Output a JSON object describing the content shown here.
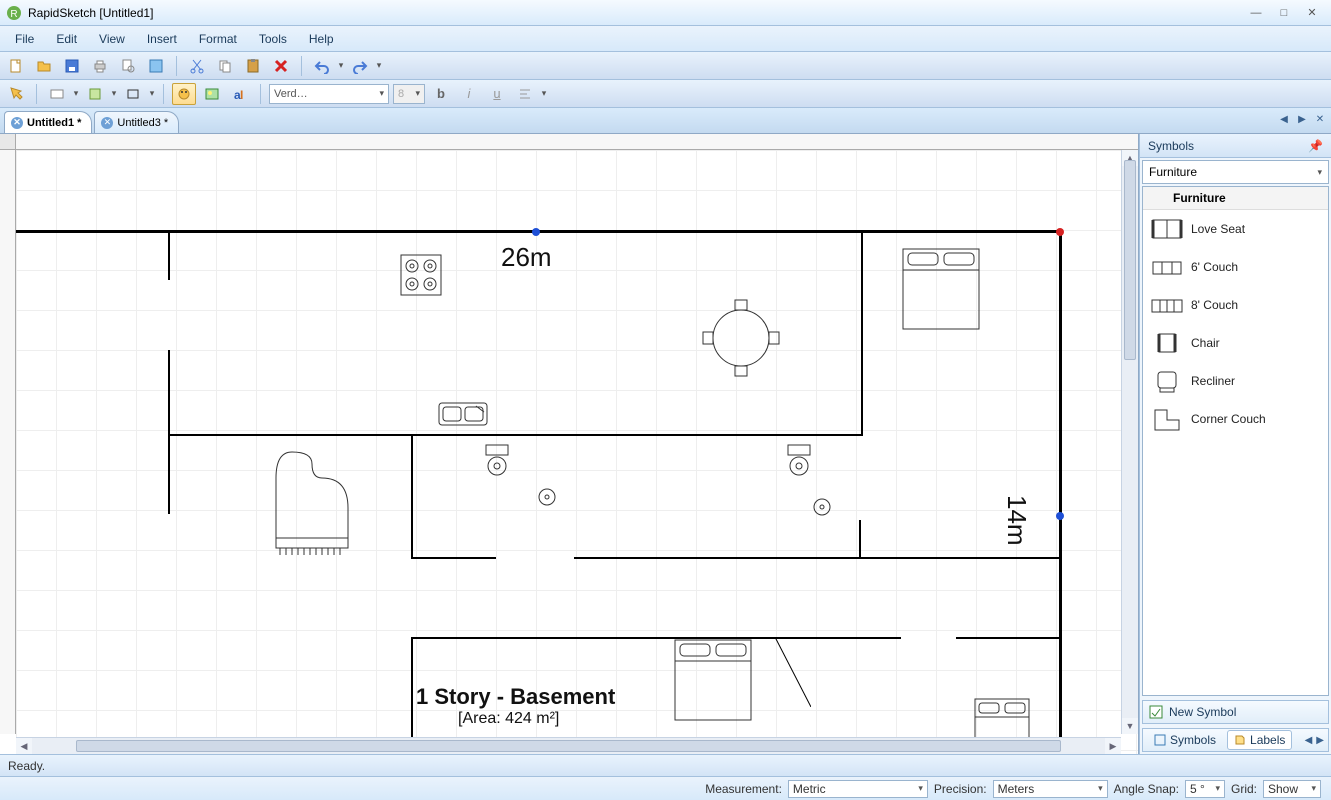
{
  "title": "RapidSketch [Untitled1]",
  "menus": [
    "File",
    "Edit",
    "View",
    "Insert",
    "Format",
    "Tools",
    "Help"
  ],
  "font_name": "Verd…",
  "font_size": "8",
  "tabs": [
    {
      "label": "Untitled1 *",
      "active": true
    },
    {
      "label": "Untitled3 *",
      "active": false
    }
  ],
  "canvas": {
    "dim_w_label": "26m",
    "dim_h_label": "14m",
    "caption": "1 Story - Basement",
    "area_label": "[Area: 424 m²]"
  },
  "sidepanel": {
    "title": "Symbols",
    "category": "Furniture",
    "group": "Furniture",
    "items": [
      "Love Seat",
      "6' Couch",
      "8' Couch",
      "Chair",
      "Recliner",
      "Corner Couch"
    ],
    "new": "New Symbol",
    "tab_symbols": "Symbols",
    "tab_labels": "Labels"
  },
  "status": "Ready.",
  "bottom": {
    "measurement_label": "Measurement:",
    "measurement_value": "Metric",
    "precision_label": "Precision:",
    "precision_value": "Meters",
    "anglesnap_label": "Angle Snap:",
    "anglesnap_value": "5 °",
    "grid_label": "Grid:",
    "grid_value": "Show"
  }
}
